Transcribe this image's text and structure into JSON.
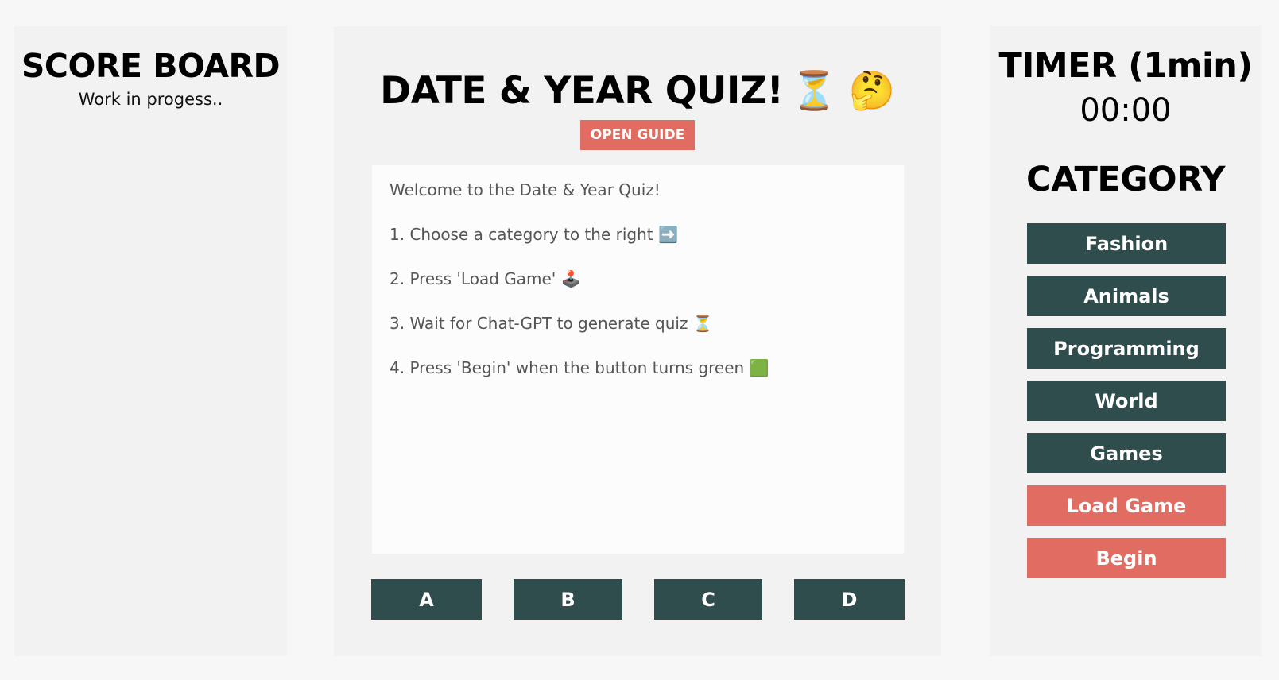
{
  "scoreboard": {
    "title": "SCORE BOARD",
    "subtitle": "Work in progess.."
  },
  "main": {
    "title": "DATE & YEAR QUIZ!",
    "title_emoji": "⏳ 🤔",
    "open_guide_label": "OPEN GUIDE",
    "guide_lines": [
      "Welcome to the Date & Year Quiz!",
      "1. Choose a category to the right ➡️",
      "2. Press 'Load Game' 🕹️",
      "3. Wait for Chat-GPT to generate quiz ⏳",
      "4. Press 'Begin' when the button turns green 🟩"
    ],
    "answers": [
      "A",
      "B",
      "C",
      "D"
    ]
  },
  "sidebar": {
    "timer_title": "TIMER (1min)",
    "timer_value": "00:00",
    "category_title": "CATEGORY",
    "categories": [
      "Fashion",
      "Animals",
      "Programming",
      "World",
      "Games"
    ],
    "load_game_label": "Load Game",
    "begin_label": "Begin"
  },
  "colors": {
    "background": "#f7f7f7",
    "panel": "#f2f2f2",
    "button_dark": "#2e4d4c",
    "button_accent": "#e06c62"
  }
}
